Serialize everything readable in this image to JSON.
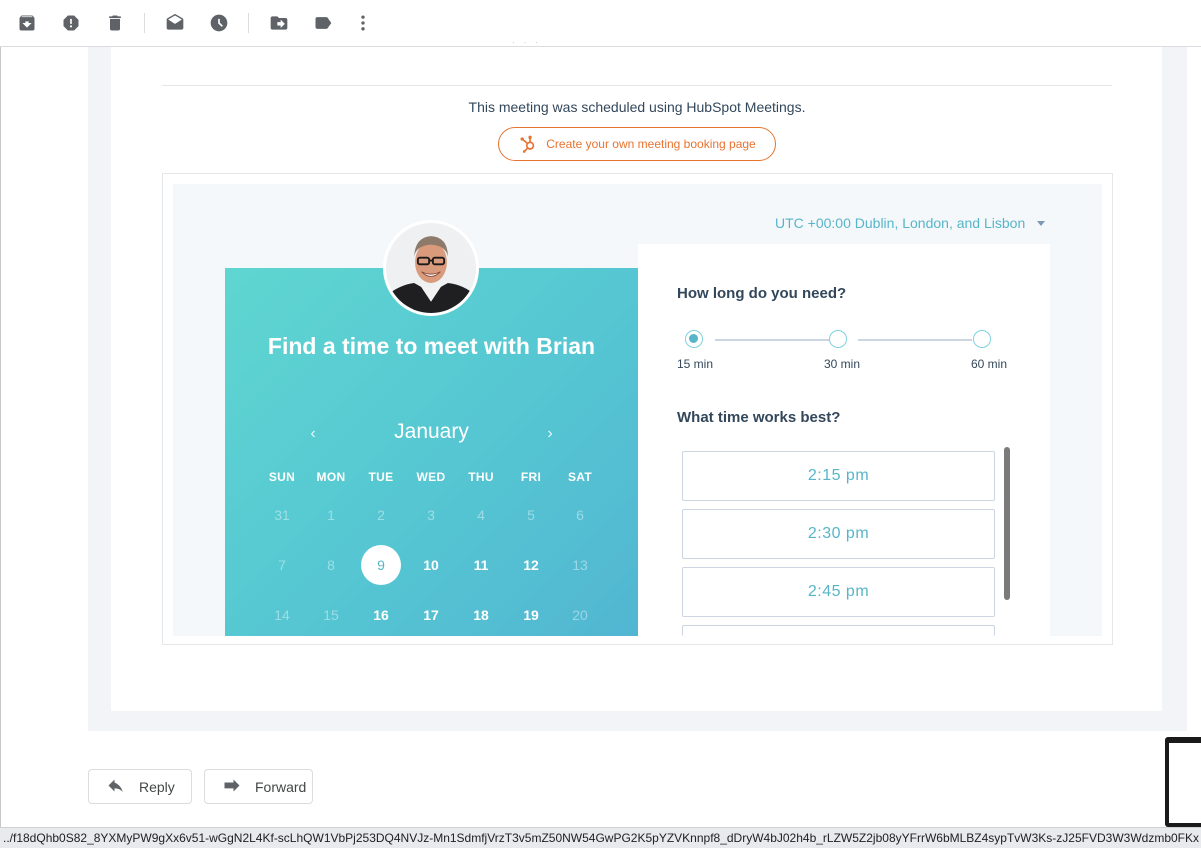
{
  "toolbar": {
    "icons": [
      "archive-icon",
      "report-spam-icon",
      "delete-icon",
      "mark-unread-icon",
      "snooze-icon",
      "move-to-icon",
      "label-icon",
      "more-options-icon"
    ]
  },
  "email": {
    "scheduled_text": "This meeting was scheduled using HubSpot Meetings.",
    "create_button": "Create your own meeting booking page"
  },
  "widget": {
    "timezone": "UTC +00:00 Dublin, London, and Lisbon",
    "title": "Find a time to meet with Brian",
    "month": "January",
    "weekdays": [
      "SUN",
      "MON",
      "TUE",
      "WED",
      "THU",
      "FRI",
      "SAT"
    ],
    "weeks": [
      [
        "31",
        "1",
        "2",
        "3",
        "4",
        "5",
        "6"
      ],
      [
        "7",
        "8",
        "9",
        "10",
        "11",
        "12",
        "13"
      ],
      [
        "14",
        "15",
        "16",
        "17",
        "18",
        "19",
        "20"
      ]
    ],
    "selected_day": "9",
    "duration_question": "How long do you need?",
    "durations": [
      "15 min",
      "30 min",
      "60 min"
    ],
    "selected_duration": "15 min",
    "time_question": "What time works best?",
    "slots": [
      "2:15 pm",
      "2:30 pm",
      "2:45 pm"
    ]
  },
  "actions": {
    "reply": "Reply",
    "forward": "Forward"
  },
  "status_bar": {
    "url": "../f18dQhb0S82_8YXMyPW9gXx6v51-wGgN2L4Kf-scLhQW1VbPj253DQ4NVJz-Mn1SdmfjVrzT3v5mZ50NW54GwPG2K5pYZVKnnpf8_dDryW4bJ02h4b_rLZW5Z2jb08yYFrrW6bMLBZ4sypTvW3Ks-zJ25FVD3W3Wdzmb0FKx"
  },
  "colors": {
    "accent_teal": "#58b5c9",
    "hubspot_orange": "#e8732f",
    "panel_gradient_start": "#5fd6d1",
    "panel_gradient_end": "#52b6d2"
  }
}
